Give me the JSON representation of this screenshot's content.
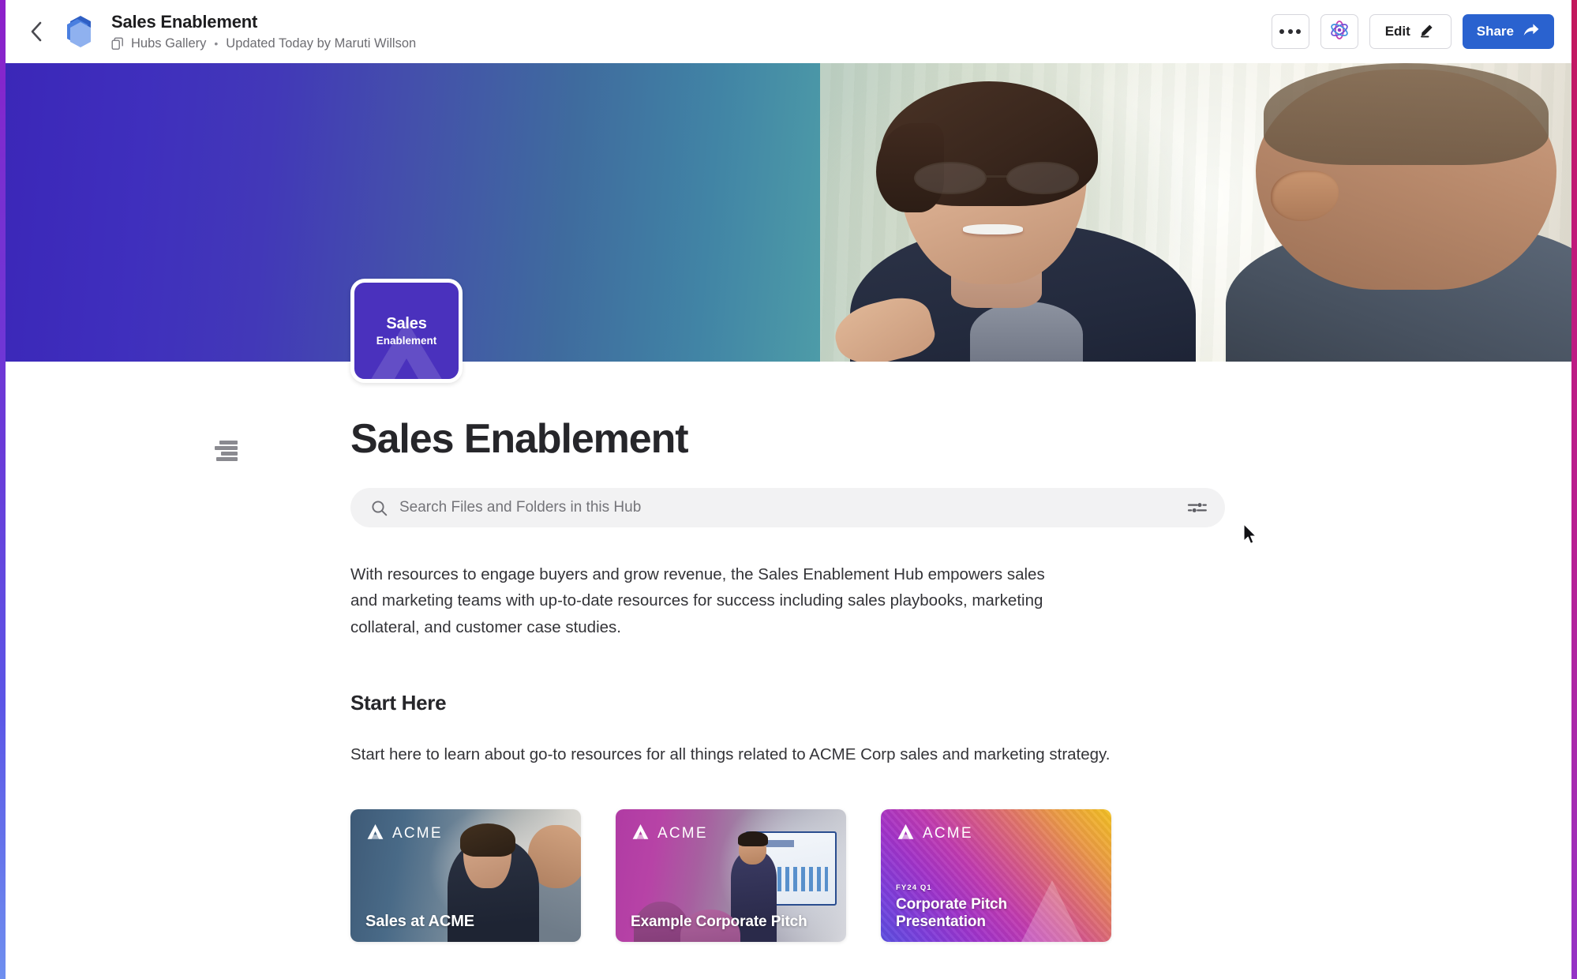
{
  "window": {
    "edge_accent_left": "#7a2fd0",
    "edge_accent_right": "#b81f92"
  },
  "topbar": {
    "back_label": "Back",
    "hub_icon": "hubs-stack-icon",
    "title": "Sales Enablement",
    "breadcrumb": "Hubs Gallery",
    "separator": "•",
    "meta": "Updated Today by Maruti Willson",
    "more_label": "More options",
    "ai_label": "AI assistant",
    "edit_label": "Edit",
    "share_label": "Share",
    "share_color": "#2a62cf"
  },
  "hero": {
    "gradient_start": "#3b27b8",
    "gradient_mid": "#4184a5",
    "gradient_end": "#f2f0e8",
    "photo_alt": "two colleagues in conversation"
  },
  "hub_tile": {
    "line1": "Sales",
    "line2": "Enablement",
    "background": "#4a31bd"
  },
  "main": {
    "toc_icon": "table-of-contents-icon",
    "page_title": "Sales Enablement",
    "search": {
      "placeholder": "Search Files and Folders in this Hub",
      "value": "",
      "search_icon": "search-icon",
      "filter_icon": "filter-sliders-icon"
    },
    "description": "With resources to engage buyers and grow revenue, the Sales Enablement Hub empowers sales and marketing teams with up-to-date resources for success including sales playbooks, marketing collateral, and customer case studies.",
    "section": {
      "title": "Start Here",
      "text": "Start here to learn about go-to resources for all things related to ACME Corp sales and marketing strategy."
    },
    "cards": [
      {
        "brand": "ACME",
        "eyebrow": "",
        "heading": "Sales at ACME",
        "theme": "photo-blue"
      },
      {
        "brand": "ACME",
        "eyebrow": "",
        "heading": "Example Corporate Pitch",
        "theme": "photo-magenta"
      },
      {
        "brand": "ACME",
        "eyebrow": "FY24 Q1",
        "heading": "Corporate Pitch Presentation",
        "theme": "gradient-sunset"
      }
    ]
  }
}
